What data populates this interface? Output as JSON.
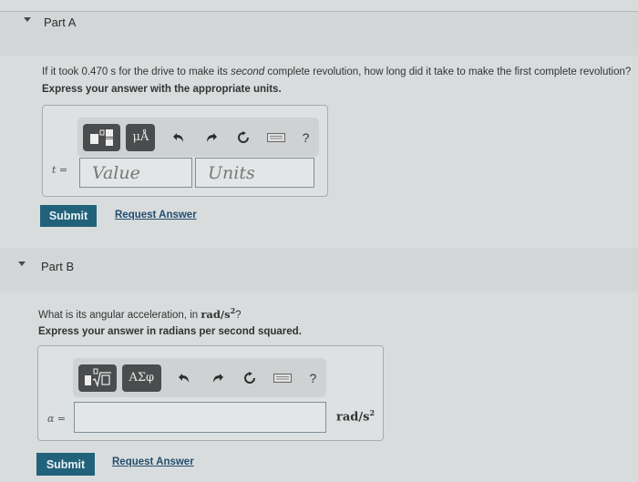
{
  "part_a": {
    "header": "Part A",
    "question_pre": "If it took 0.470 s for the drive to make its ",
    "question_em": "second",
    "question_post": " complete revolution, how long did it take to make the first complete revolution?",
    "instruction": "Express your answer with the appropriate units.",
    "toolbar": {
      "template_icon": "fraction-template-icon",
      "units_label": "μÅ",
      "undo": "↶",
      "redo": "↷",
      "reset": "↻",
      "keyboard": "keyboard-icon",
      "help": "?"
    },
    "variable_label": "t =",
    "value_placeholder": "Value",
    "units_placeholder": "Units",
    "submit_label": "Submit",
    "request_answer_label": "Request Answer"
  },
  "part_b": {
    "header": "Part B",
    "question_pre": "What is its angular acceleration, in ",
    "question_unit": "rad/s",
    "question_unit_exp": "2",
    "question_post": "?",
    "instruction": "Express your answer in radians per second squared.",
    "toolbar": {
      "template_icon": "radical-template-icon",
      "symbols_label": "ΑΣφ",
      "undo": "↶",
      "redo": "↷",
      "reset": "↻",
      "keyboard": "keyboard-icon",
      "help": "?"
    },
    "variable_label": "α =",
    "answer_value": "",
    "unit_label": "rad/s",
    "unit_exp": "2",
    "submit_label": "Submit",
    "request_answer_label": "Request Answer"
  },
  "colors": {
    "submit_bg": "#22617a",
    "link": "#234e6e",
    "tool_dark": "#4a4c4d"
  }
}
